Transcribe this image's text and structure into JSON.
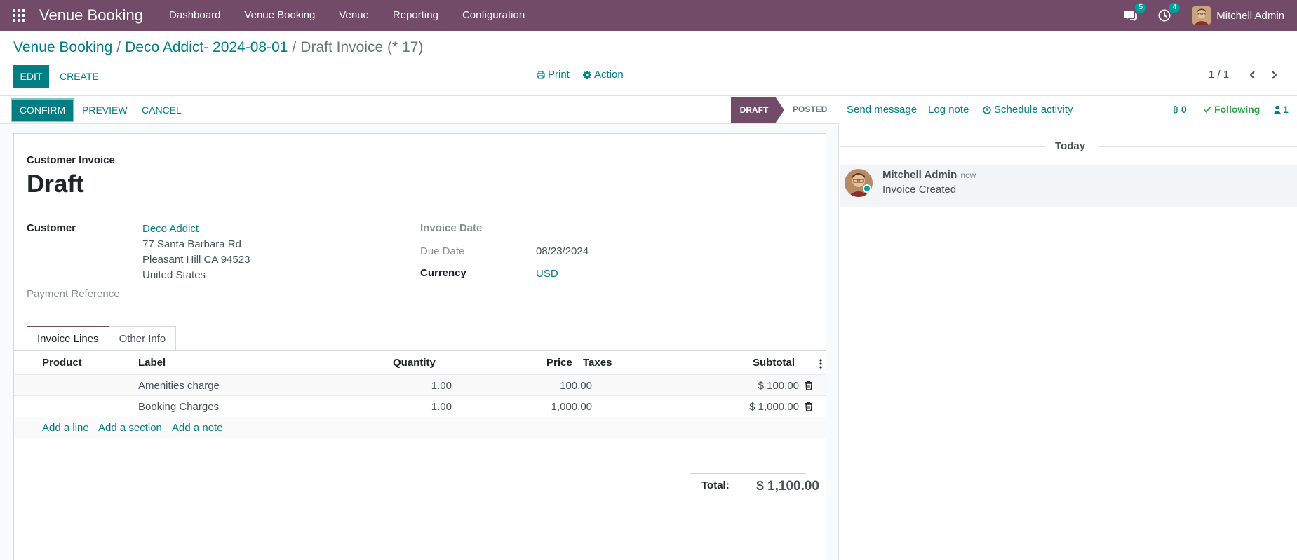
{
  "navbar": {
    "brand": "Venue Booking",
    "menu": [
      "Dashboard",
      "Venue Booking",
      "Venue",
      "Reporting",
      "Configuration"
    ],
    "messages_badge": "5",
    "activities_badge": "4",
    "user_name": "Mitchell Admin"
  },
  "breadcrumb": {
    "root": "Venue Booking",
    "parent": "Deco Addict- 2024-08-01",
    "current": "Draft Invoice (* 17)"
  },
  "control_panel": {
    "edit_label": "EDIT",
    "create_label": "CREATE",
    "print_label": "Print",
    "action_label": "Action",
    "pager": "1 / 1"
  },
  "statusbar": {
    "confirm_label": "CONFIRM",
    "preview_label": "PREVIEW",
    "cancel_label": "CANCEL",
    "stages": [
      "DRAFT",
      "POSTED"
    ],
    "active_stage": "DRAFT"
  },
  "form": {
    "doc_type": "Customer Invoice",
    "doc_name": "Draft",
    "customer_label": "Customer",
    "customer_name": "Deco Addict",
    "customer_address": [
      "77 Santa Barbara Rd",
      "Pleasant Hill CA 94523",
      "United States"
    ],
    "payment_reference_label": "Payment Reference",
    "invoice_date_label": "Invoice Date",
    "due_date_label": "Due Date",
    "due_date": "08/23/2024",
    "currency_label": "Currency",
    "currency": "USD",
    "tabs": [
      "Invoice Lines",
      "Other Info"
    ],
    "columns": [
      "Product",
      "Label",
      "Quantity",
      "Price",
      "Taxes",
      "Subtotal"
    ],
    "lines": [
      {
        "product": "",
        "label": "Amenities charge",
        "quantity": "1.00",
        "price": "100.00",
        "taxes": "",
        "subtotal": "$ 100.00"
      },
      {
        "product": "",
        "label": "Booking Charges",
        "quantity": "1.00",
        "price": "1,000.00",
        "taxes": "",
        "subtotal": "$ 1,000.00"
      }
    ],
    "add_line": "Add a line",
    "add_section": "Add a section",
    "add_note": "Add a note",
    "total_label": "Total:",
    "total_value": "$ 1,100.00"
  },
  "chatter": {
    "send_message": "Send message",
    "log_note": "Log note",
    "schedule_activity": "Schedule activity",
    "attachments_count": "0",
    "following_label": "Following",
    "followers_count": "1",
    "date_separator": "Today",
    "messages": [
      {
        "author": "Mitchell Admin",
        "time": "- now",
        "body": "Invoice Created"
      }
    ]
  },
  "colors": {
    "brand": "#714B67",
    "accent": "#017e84",
    "badge": "#00A09D",
    "following": "#28a745"
  }
}
